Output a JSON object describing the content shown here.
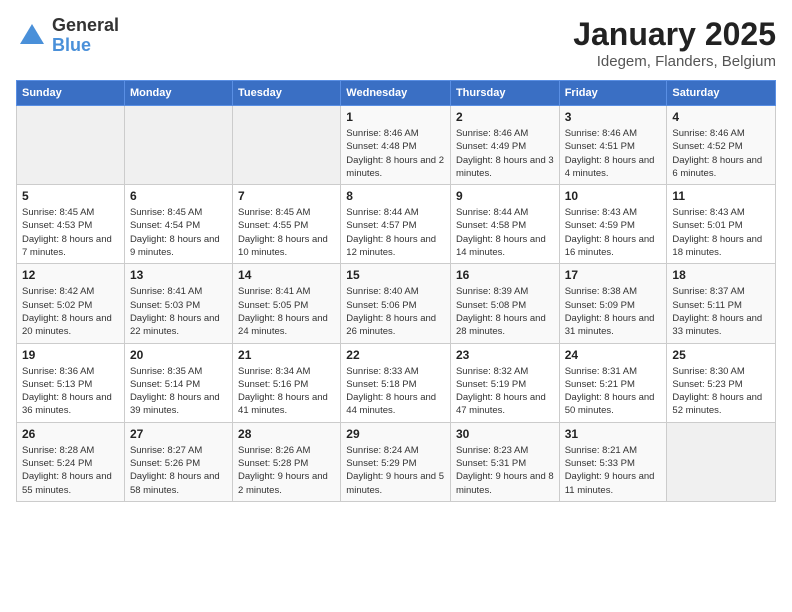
{
  "header": {
    "logo_general": "General",
    "logo_blue": "Blue",
    "title": "January 2025",
    "subtitle": "Idegem, Flanders, Belgium"
  },
  "weekdays": [
    "Sunday",
    "Monday",
    "Tuesday",
    "Wednesday",
    "Thursday",
    "Friday",
    "Saturday"
  ],
  "weeks": [
    [
      {
        "day": "",
        "info": ""
      },
      {
        "day": "",
        "info": ""
      },
      {
        "day": "",
        "info": ""
      },
      {
        "day": "1",
        "info": "Sunrise: 8:46 AM\nSunset: 4:48 PM\nDaylight: 8 hours and 2 minutes."
      },
      {
        "day": "2",
        "info": "Sunrise: 8:46 AM\nSunset: 4:49 PM\nDaylight: 8 hours and 3 minutes."
      },
      {
        "day": "3",
        "info": "Sunrise: 8:46 AM\nSunset: 4:51 PM\nDaylight: 8 hours and 4 minutes."
      },
      {
        "day": "4",
        "info": "Sunrise: 8:46 AM\nSunset: 4:52 PM\nDaylight: 8 hours and 6 minutes."
      }
    ],
    [
      {
        "day": "5",
        "info": "Sunrise: 8:45 AM\nSunset: 4:53 PM\nDaylight: 8 hours and 7 minutes."
      },
      {
        "day": "6",
        "info": "Sunrise: 8:45 AM\nSunset: 4:54 PM\nDaylight: 8 hours and 9 minutes."
      },
      {
        "day": "7",
        "info": "Sunrise: 8:45 AM\nSunset: 4:55 PM\nDaylight: 8 hours and 10 minutes."
      },
      {
        "day": "8",
        "info": "Sunrise: 8:44 AM\nSunset: 4:57 PM\nDaylight: 8 hours and 12 minutes."
      },
      {
        "day": "9",
        "info": "Sunrise: 8:44 AM\nSunset: 4:58 PM\nDaylight: 8 hours and 14 minutes."
      },
      {
        "day": "10",
        "info": "Sunrise: 8:43 AM\nSunset: 4:59 PM\nDaylight: 8 hours and 16 minutes."
      },
      {
        "day": "11",
        "info": "Sunrise: 8:43 AM\nSunset: 5:01 PM\nDaylight: 8 hours and 18 minutes."
      }
    ],
    [
      {
        "day": "12",
        "info": "Sunrise: 8:42 AM\nSunset: 5:02 PM\nDaylight: 8 hours and 20 minutes."
      },
      {
        "day": "13",
        "info": "Sunrise: 8:41 AM\nSunset: 5:03 PM\nDaylight: 8 hours and 22 minutes."
      },
      {
        "day": "14",
        "info": "Sunrise: 8:41 AM\nSunset: 5:05 PM\nDaylight: 8 hours and 24 minutes."
      },
      {
        "day": "15",
        "info": "Sunrise: 8:40 AM\nSunset: 5:06 PM\nDaylight: 8 hours and 26 minutes."
      },
      {
        "day": "16",
        "info": "Sunrise: 8:39 AM\nSunset: 5:08 PM\nDaylight: 8 hours and 28 minutes."
      },
      {
        "day": "17",
        "info": "Sunrise: 8:38 AM\nSunset: 5:09 PM\nDaylight: 8 hours and 31 minutes."
      },
      {
        "day": "18",
        "info": "Sunrise: 8:37 AM\nSunset: 5:11 PM\nDaylight: 8 hours and 33 minutes."
      }
    ],
    [
      {
        "day": "19",
        "info": "Sunrise: 8:36 AM\nSunset: 5:13 PM\nDaylight: 8 hours and 36 minutes."
      },
      {
        "day": "20",
        "info": "Sunrise: 8:35 AM\nSunset: 5:14 PM\nDaylight: 8 hours and 39 minutes."
      },
      {
        "day": "21",
        "info": "Sunrise: 8:34 AM\nSunset: 5:16 PM\nDaylight: 8 hours and 41 minutes."
      },
      {
        "day": "22",
        "info": "Sunrise: 8:33 AM\nSunset: 5:18 PM\nDaylight: 8 hours and 44 minutes."
      },
      {
        "day": "23",
        "info": "Sunrise: 8:32 AM\nSunset: 5:19 PM\nDaylight: 8 hours and 47 minutes."
      },
      {
        "day": "24",
        "info": "Sunrise: 8:31 AM\nSunset: 5:21 PM\nDaylight: 8 hours and 50 minutes."
      },
      {
        "day": "25",
        "info": "Sunrise: 8:30 AM\nSunset: 5:23 PM\nDaylight: 8 hours and 52 minutes."
      }
    ],
    [
      {
        "day": "26",
        "info": "Sunrise: 8:28 AM\nSunset: 5:24 PM\nDaylight: 8 hours and 55 minutes."
      },
      {
        "day": "27",
        "info": "Sunrise: 8:27 AM\nSunset: 5:26 PM\nDaylight: 8 hours and 58 minutes."
      },
      {
        "day": "28",
        "info": "Sunrise: 8:26 AM\nSunset: 5:28 PM\nDaylight: 9 hours and 2 minutes."
      },
      {
        "day": "29",
        "info": "Sunrise: 8:24 AM\nSunset: 5:29 PM\nDaylight: 9 hours and 5 minutes."
      },
      {
        "day": "30",
        "info": "Sunrise: 8:23 AM\nSunset: 5:31 PM\nDaylight: 9 hours and 8 minutes."
      },
      {
        "day": "31",
        "info": "Sunrise: 8:21 AM\nSunset: 5:33 PM\nDaylight: 9 hours and 11 minutes."
      },
      {
        "day": "",
        "info": ""
      }
    ]
  ]
}
